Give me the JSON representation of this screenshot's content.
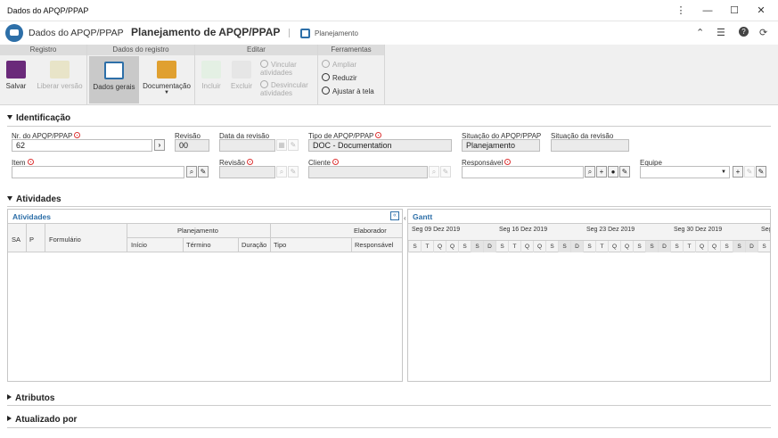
{
  "window": {
    "title": "Dados do APQP/PPAP",
    "min": "⋮",
    "minimize": "—",
    "maximize": "☐",
    "close": "✕"
  },
  "header": {
    "app": "Dados do APQP/PPAP",
    "chevron": "›",
    "title": "Planejamento de APQP/PPAP",
    "plan_label": "Planejamento"
  },
  "ribbon": {
    "groups": {
      "registro": "Registro",
      "dados": "Dados do registro",
      "editar": "Editar",
      "ferramentas": "Ferramentas"
    },
    "salvar": "Salvar",
    "liberar": "Liberar versão",
    "dados_gerais": "Dados gerais",
    "documentacao": "Documentação",
    "incluir": "Incluir",
    "excluir": "Excluir",
    "vincular": "Vincular atividades",
    "desvincular": "Desvincular atividades",
    "ampliar": "Ampliar",
    "reduzir": "Reduzir",
    "ajustar": "Ajustar à tela"
  },
  "identificacao": {
    "section": "Identificação",
    "nr_label": "Nr. do APQP/PPAP",
    "nr_value": "62",
    "revisao_label": "Revisão",
    "revisao_value": "00",
    "data_rev_label": "Data da revisão",
    "tipo_label": "Tipo de APQP/PPAP",
    "tipo_value": "DOC - Documentation",
    "situacao_label": "Situação do APQP/PPAP",
    "situacao_value": "Planejamento",
    "sit_rev_label": "Situação da revisão",
    "item_label": "Item",
    "item_rev_label": "Revisão",
    "cliente_label": "Cliente",
    "responsavel_label": "Responsável",
    "equipe_label": "Equipe"
  },
  "atividades": {
    "section": "Atividades",
    "panel_title": "Atividades",
    "cols": {
      "sa": "SA",
      "p": "P",
      "formulario": "Formulário",
      "planejamento": "Planejamento",
      "elaborador": "Elaborador",
      "inicio": "Início",
      "termino": "Término",
      "duracao": "Duração",
      "tipo": "Tipo",
      "responsavel": "Responsável"
    },
    "gantt_title": "Gantt",
    "weeks": [
      "Seg 09 Dez 2019",
      "Seg 16 Dez 2019",
      "Seg 23 Dez 2019",
      "Seg 30 Dez 2019",
      "Seg"
    ],
    "days": [
      "S",
      "T",
      "Q",
      "Q",
      "S",
      "S",
      "D"
    ]
  },
  "atributos": {
    "section": "Atributos"
  },
  "atualizado": {
    "section": "Atualizado por"
  }
}
